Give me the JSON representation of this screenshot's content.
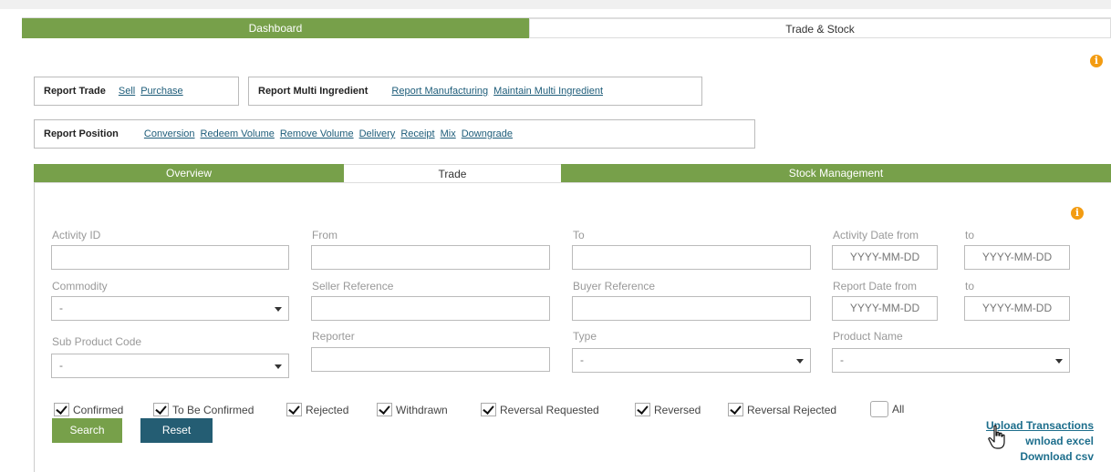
{
  "main_tabs": [
    "Dashboard",
    "Trade & Stock"
  ],
  "report_trade": {
    "label": "Report Trade",
    "links": [
      "Sell",
      "Purchase"
    ]
  },
  "report_multi": {
    "label": "Report Multi Ingredient",
    "links": [
      "Report Manufacturing",
      "Maintain Multi Ingredient"
    ]
  },
  "report_position": {
    "label": "Report Position",
    "links": [
      "Conversion",
      "Redeem Volume",
      "Remove Volume",
      "Delivery",
      "Receipt",
      "Mix",
      "Downgrade"
    ]
  },
  "sub_tabs": [
    "Overview",
    "Trade",
    "Stock Management"
  ],
  "filters": {
    "activity_id": {
      "label": "Activity ID",
      "value": ""
    },
    "from": {
      "label": "From",
      "value": ""
    },
    "to": {
      "label": "To",
      "value": ""
    },
    "activity_date_from": {
      "label": "Activity Date from",
      "placeholder": "YYYY-MM-DD"
    },
    "activity_date_to": {
      "label": "to",
      "placeholder": "YYYY-MM-DD"
    },
    "commodity": {
      "label": "Commodity",
      "value": "-"
    },
    "seller_reference": {
      "label": "Seller Reference",
      "value": ""
    },
    "buyer_reference": {
      "label": "Buyer Reference",
      "value": ""
    },
    "report_date_from": {
      "label": "Report Date from",
      "placeholder": "YYYY-MM-DD"
    },
    "report_date_to": {
      "label": "to",
      "placeholder": "YYYY-MM-DD"
    },
    "sub_product_code": {
      "label": "Sub Product Code",
      "value": "-"
    },
    "reporter": {
      "label": "Reporter",
      "value": ""
    },
    "type": {
      "label": "Type",
      "value": "-"
    },
    "product_name": {
      "label": "Product Name",
      "value": "-"
    }
  },
  "statuses": [
    {
      "label": "Confirmed",
      "checked": true
    },
    {
      "label": "To Be Confirmed",
      "checked": true
    },
    {
      "label": "Rejected",
      "checked": true
    },
    {
      "label": "Withdrawn",
      "checked": true
    },
    {
      "label": "Reversal Requested",
      "checked": true
    },
    {
      "label": "Reversed",
      "checked": true
    },
    {
      "label": "Reversal Rejected",
      "checked": true
    },
    {
      "label": "All",
      "checked": false
    }
  ],
  "buttons": {
    "search": "Search",
    "reset": "Reset"
  },
  "actions": {
    "upload": "Upload Transactions",
    "excel": "wnload excel",
    "csv": "Download csv"
  },
  "colors": {
    "green": "#77a04a",
    "dark_teal": "#245d73",
    "link": "#1d5c79",
    "info": "#f39c12"
  },
  "icons": {
    "info": "info-icon",
    "cursor": "hand-pointer-icon"
  }
}
